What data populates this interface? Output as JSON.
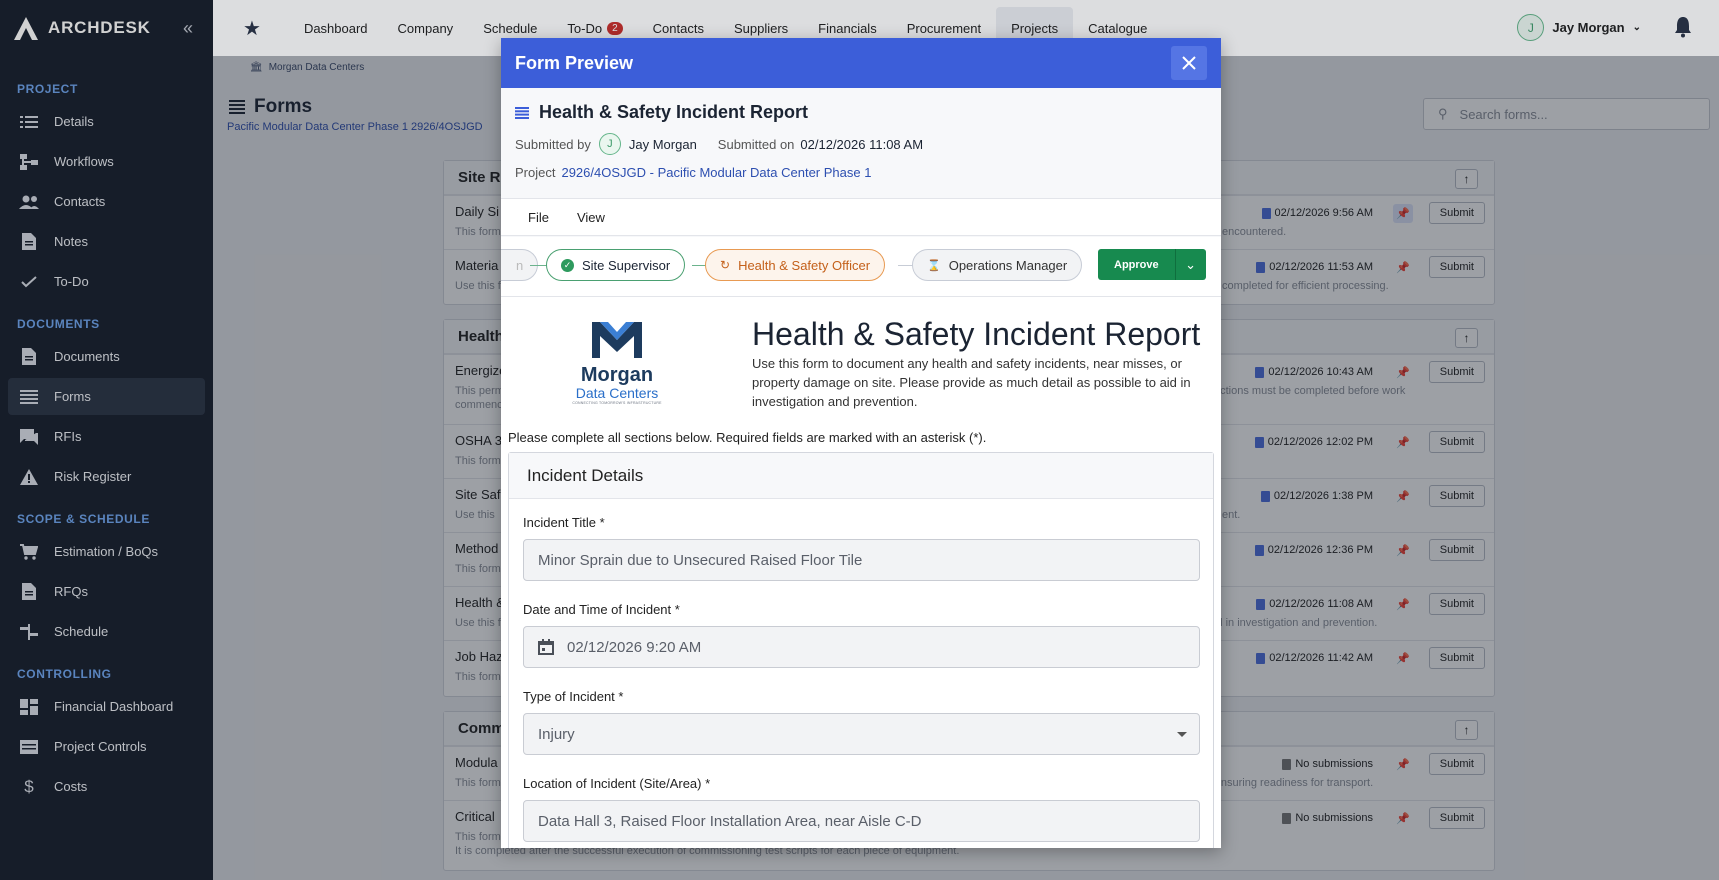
{
  "sidebar": {
    "brand": "ARCHDESK",
    "sections": [
      {
        "title": "PROJECT",
        "items": [
          "Details",
          "Workflows",
          "Contacts",
          "Notes",
          "To-Do"
        ]
      },
      {
        "title": "DOCUMENTS",
        "items": [
          "Documents",
          "Forms",
          "RFIs",
          "Risk Register"
        ]
      },
      {
        "title": "SCOPE & SCHEDULE",
        "items": [
          "Estimation / BoQs",
          "RFQs",
          "Schedule"
        ]
      },
      {
        "title": "CONTROLLING",
        "items": [
          "Financial Dashboard",
          "Project Controls",
          "Costs"
        ]
      }
    ],
    "active": "Forms"
  },
  "topnav": {
    "tabs": [
      "Dashboard",
      "Company",
      "Schedule",
      "To-Do",
      "Contacts",
      "Suppliers",
      "Financials",
      "Procurement",
      "Projects",
      "Catalogue"
    ],
    "todo_badge": "2",
    "active": "Projects",
    "user_initial": "J",
    "user_name": "Jay Morgan"
  },
  "page": {
    "breadcrumb": "Morgan Data Centers",
    "title": "Forms",
    "subtitle": "Pacific Modular Data Center Phase 1 2926/4OSJGD",
    "search_placeholder": "Search forms..."
  },
  "cards": [
    {
      "title": "Site Re",
      "rows": [
        {
          "title": "Daily Si",
          "desc": "This form",
          "desc_right": "encountered.",
          "date": "02/12/2026 9:56 AM",
          "pinned": true,
          "submit": "Submit"
        },
        {
          "title": "Materia",
          "desc": "Use this f",
          "desc_right": "completed for efficient processing.",
          "date": "02/12/2026 11:53 AM",
          "pinned": false,
          "submit": "Submit"
        }
      ]
    },
    {
      "title": "Health",
      "rows": [
        {
          "title": "Energize",
          "desc": "This perm",
          "desc2": "commenc",
          "desc_right": "ections must be completed before work",
          "date": "02/12/2026 10:43 AM",
          "pinned": false,
          "submit": "Submit"
        },
        {
          "title": "OSHA 3",
          "desc": "This form",
          "desc_right": "",
          "date": "02/12/2026 12:02 PM",
          "pinned": false,
          "submit": "Submit"
        },
        {
          "title": "Site Saf",
          "desc": "Use this",
          "desc_right": "ent.",
          "date": "02/12/2026 1:38 PM",
          "pinned": false,
          "submit": "Submit"
        },
        {
          "title": "Method",
          "desc": "This form",
          "desc_right": "",
          "date": "02/12/2026 12:36 PM",
          "pinned": false,
          "submit": "Submit"
        },
        {
          "title": "Health &",
          "desc": "Use this f",
          "desc_right": "id in investigation and prevention.",
          "date": "02/12/2026 11:08 AM",
          "pinned": false,
          "submit": "Submit"
        },
        {
          "title": "Job Haz",
          "desc": "This form",
          "desc_right": "",
          "date": "02/12/2026 11:42 AM",
          "pinned": false,
          "submit": "Submit"
        }
      ]
    },
    {
      "title": "Comm",
      "rows": [
        {
          "title": "Modula",
          "desc": "This form",
          "desc_right": "y, ensuring readiness for transport.",
          "date": "No submissions",
          "pinned": false,
          "submit": "Submit"
        },
        {
          "title": "Critical",
          "desc": "This form",
          "desc2": "It is completed after the successful execution of commissioning test scripts for each piece of equipment.",
          "desc_right": "",
          "date": "No submissions",
          "pinned": false,
          "submit": "Submit"
        }
      ]
    }
  ],
  "modal": {
    "header": "Form Preview",
    "form_title": "Health & Safety Incident Report",
    "submitted_by_label": "Submitted by",
    "submitted_by_initial": "J",
    "submitted_by": "Jay Morgan",
    "submitted_on_label": "Submitted on",
    "submitted_on": "02/12/2026 11:08 AM",
    "project_label": "Project",
    "project": "2926/4OSJGD - Pacific Modular Data Center Phase 1",
    "menu": [
      "File",
      "View"
    ],
    "workflow": {
      "partial": "n",
      "steps": [
        "Site Supervisor",
        "Health & Safety Officer",
        "Operations Manager"
      ],
      "approve": "Approve"
    },
    "logo": {
      "line1": "Morgan",
      "line2": "Data Centers",
      "tagline": "CONNECTING TOMORROW'S INFRASTRUCTURE"
    },
    "heading": "Health & Safety Incident Report",
    "description": "Use this form to document any health and safety incidents, near misses, or property damage on site. Please provide as much detail as possible to aid in investigation and prevention.",
    "instructions": "Please complete all sections below. Required fields are marked with an asterisk (*).",
    "section_title": "Incident Details",
    "fields": [
      {
        "label": "Incident Title *",
        "value": "Minor Sprain due to Unsecured Raised Floor Tile"
      },
      {
        "label": "Date and Time of Incident *",
        "value": "02/12/2026 9:20 AM"
      },
      {
        "label": "Type of Incident *",
        "value": "Injury"
      },
      {
        "label": "Location of Incident (Site/Area) *",
        "value": "Data Hall 3, Raised Floor Installation Area, near Aisle C-D"
      }
    ]
  },
  "colors": {
    "sidebar": "#1b2433",
    "modal_header": "#3c5ed9",
    "approve": "#178a4f",
    "accent": "#6ea2e8"
  }
}
